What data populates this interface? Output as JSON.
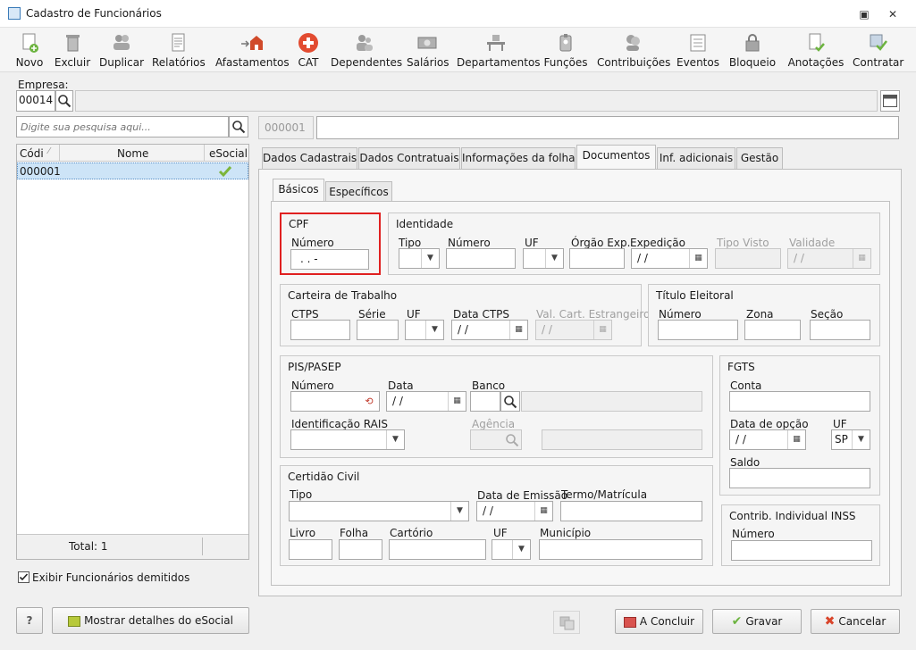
{
  "window": {
    "title": "Cadastro de Funcionários"
  },
  "toolbar": [
    {
      "label": "Novo",
      "icon": "new-doc-icon"
    },
    {
      "label": "Excluir",
      "icon": "trash-icon"
    },
    {
      "label": "Duplicar",
      "icon": "duplicate-users-icon"
    },
    {
      "label": "Relatórios",
      "icon": "report-icon"
    },
    {
      "label": "Afastamentos",
      "icon": "leave-house-icon"
    },
    {
      "label": "CAT",
      "icon": "medical-cross-icon"
    },
    {
      "label": "Dependentes",
      "icon": "dependents-icon"
    },
    {
      "label": "Salários",
      "icon": "salary-icon"
    },
    {
      "label": "Departamentos",
      "icon": "desk-icon"
    },
    {
      "label": "Funções",
      "icon": "badge-icon"
    },
    {
      "label": "Contribuições",
      "icon": "contributions-icon"
    },
    {
      "label": "Eventos",
      "icon": "events-list-icon"
    },
    {
      "label": "Bloqueio",
      "icon": "lock-icon"
    },
    {
      "label": "Anotações",
      "icon": "notes-check-icon"
    },
    {
      "label": "Contratar",
      "icon": "hire-check-icon"
    }
  ],
  "empresa": {
    "label": "Empresa:",
    "code": "00014",
    "name": ""
  },
  "search": {
    "placeholder": "Digite sua pesquisa aqui..."
  },
  "list": {
    "headers": [
      "Códi",
      "Nome",
      "eSocial"
    ],
    "rows": [
      {
        "code": "000001",
        "name": "",
        "esocial": "check"
      }
    ],
    "total": "Total: 1"
  },
  "employee": {
    "code": "000001",
    "name": ""
  },
  "show_dismissed": {
    "label": "Exibir Funcionários demitidos",
    "checked": true
  },
  "tabs": [
    "Dados Cadastrais",
    "Dados Contratuais",
    "Informações da folha",
    "Documentos",
    "Inf. adicionais",
    "Gestão"
  ],
  "active_tab": "Documentos",
  "subtabs": [
    "Básicos",
    "Específicos"
  ],
  "active_subtab": "Básicos",
  "cpf": {
    "title": "CPF",
    "numero_label": "Número",
    "numero_value": ". . -",
    "highlight": "#e02020"
  },
  "identidade": {
    "title": "Identidade",
    "tipo": "Tipo",
    "numero": "Número",
    "uf": "UF",
    "orgao": "Órgão Exp.",
    "expedicao": "Expedição",
    "expedicao_value": "/ /",
    "tipo_visto": "Tipo Visto",
    "validade": "Validade",
    "validade_value": "/ /"
  },
  "ctps": {
    "title": "Carteira de Trabalho",
    "ctps": "CTPS",
    "serie": "Série",
    "uf": "UF",
    "data": "Data CTPS",
    "data_value": "/ /",
    "val_estr": "Val. Cart. Estrangeiro",
    "val_estr_value": "/ /"
  },
  "titulo": {
    "title": "Título Eleitoral",
    "numero": "Número",
    "zona": "Zona",
    "secao": "Seção"
  },
  "pis": {
    "title": "PIS/PASEP",
    "numero": "Número",
    "data": "Data",
    "data_value": "/ /",
    "banco": "Banco",
    "rais": "Identificação RAIS",
    "agencia": "Agência"
  },
  "fgts": {
    "title": "FGTS",
    "conta": "Conta",
    "data_opcao": "Data de opção",
    "data_value": "/ /",
    "uf": "UF",
    "uf_value": "SP",
    "saldo": "Saldo"
  },
  "certidao": {
    "title": "Certidão Civil",
    "tipo": "Tipo",
    "data_emissao": "Data de Emissão",
    "data_value": "/ /",
    "termo": "Termo/Matrícula",
    "livro": "Livro",
    "folha": "Folha",
    "cartorio": "Cartório",
    "uf": "UF",
    "municipio": "Município"
  },
  "inss": {
    "title": "Contrib. Individual INSS",
    "numero": "Número"
  },
  "footer": {
    "help": "?",
    "esocial_details": "Mostrar detalhes do eSocial",
    "concluir": "A Concluir",
    "gravar": "Gravar",
    "cancelar": "Cancelar"
  }
}
